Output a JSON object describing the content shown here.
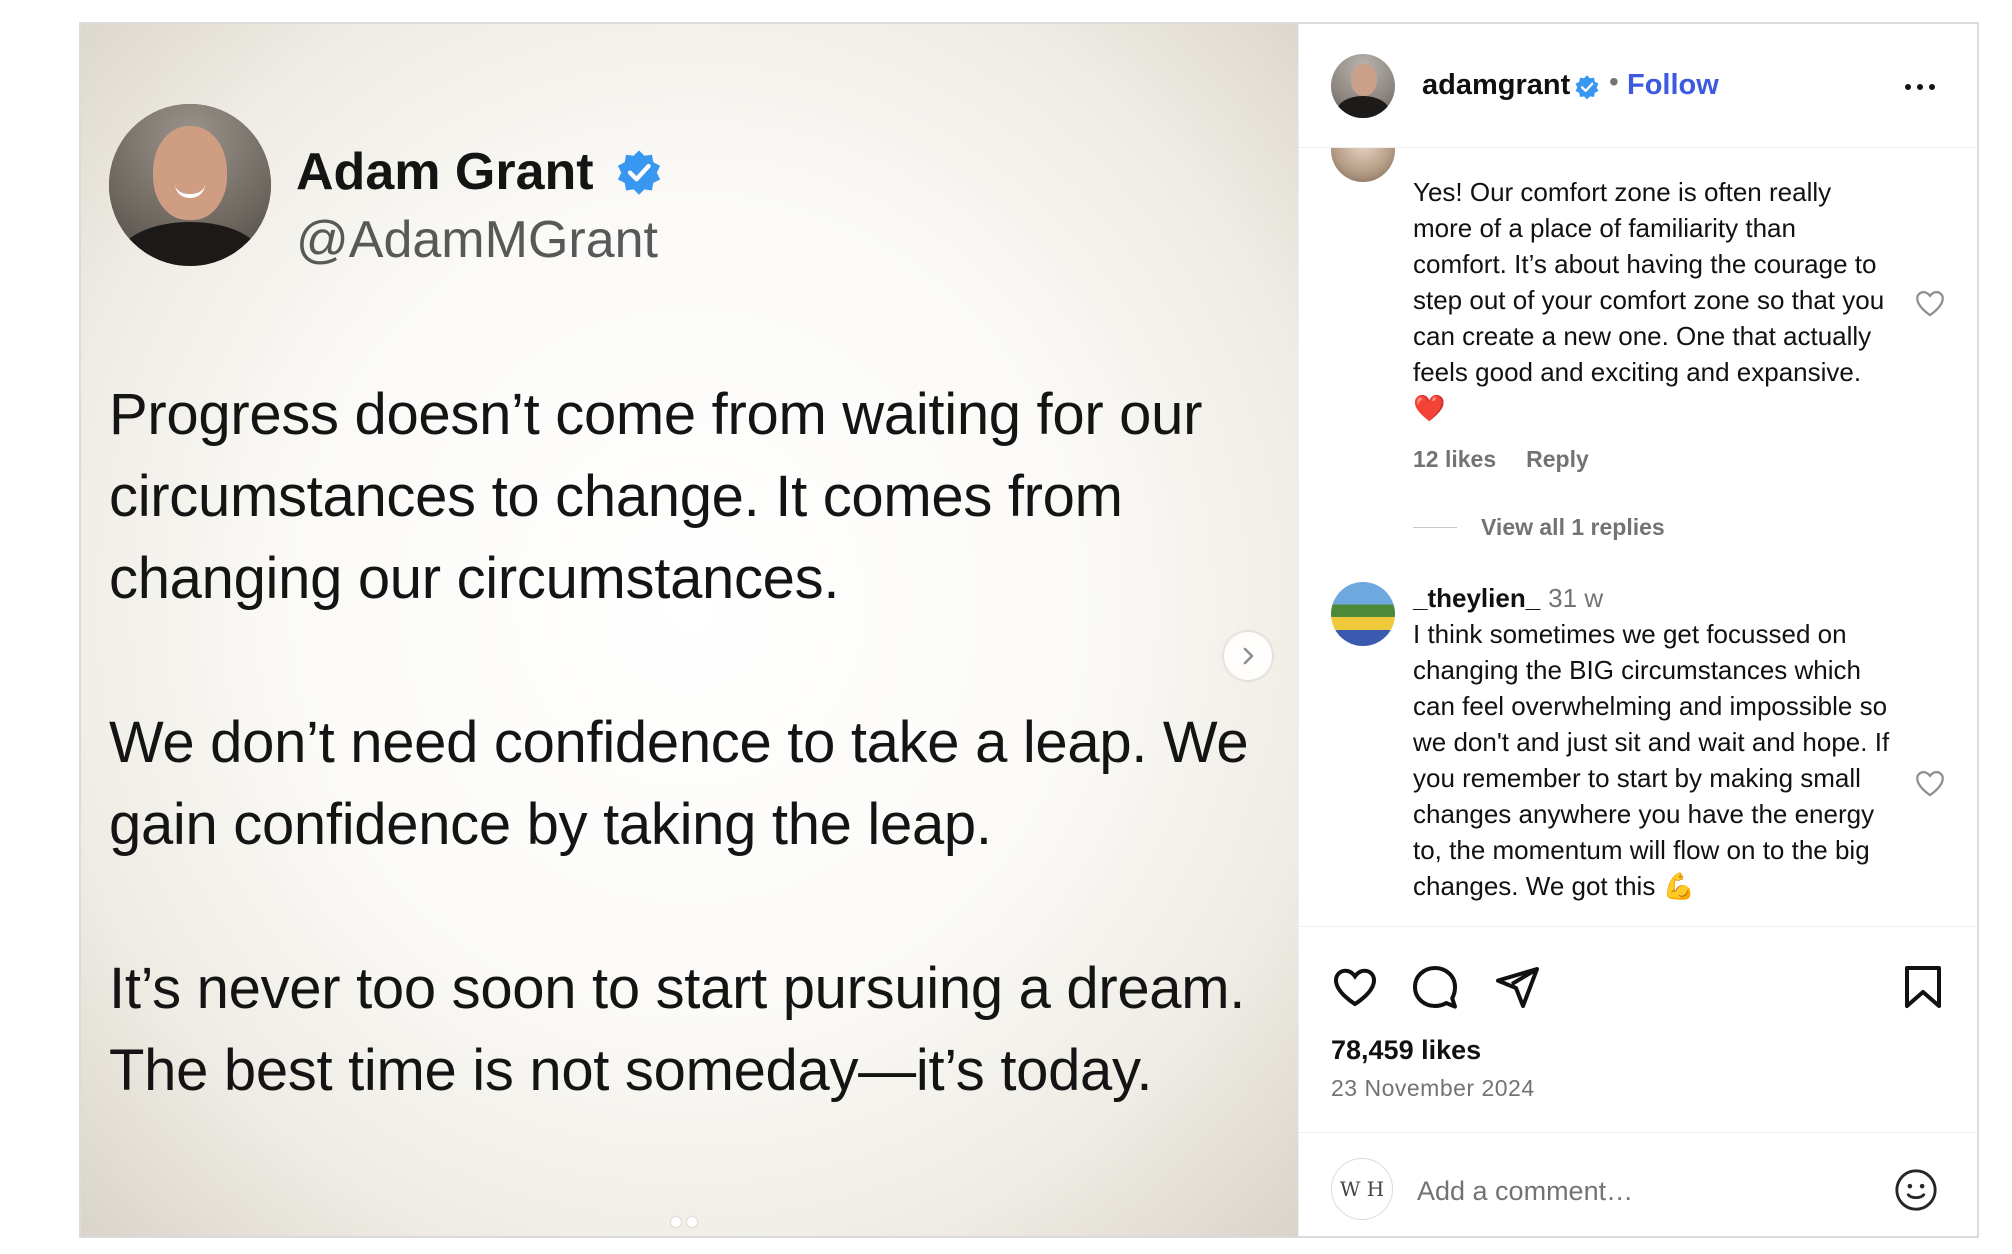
{
  "tweet": {
    "name": "Adam Grant",
    "handle": "@AdamMGrant",
    "body": "Progress doesn’t come from waiting for our circumstances to change. It comes from changing our circumstances.\n\nWe don’t need confidence to take a leap. We gain confidence by taking the leap.\n\nIt’s never too soon to start pursuing a dream. The best time is not someday—it’s today."
  },
  "post_header": {
    "username": "adamgrant",
    "separator": "•",
    "follow_label": "Follow"
  },
  "comments": [
    {
      "text": "Yes! Our comfort zone is often really more of a place of familiarity than comfort. It’s about having the courage to step out of your comfort zone so that you can create a new one. One that actually feels good and exciting and expansive.❤️",
      "likes": "12 likes",
      "reply_label": "Reply",
      "view_replies": "View all 1 replies"
    },
    {
      "username": "_theylien_",
      "time": "31 w",
      "text": "I think sometimes we get focussed on changing the BIG circumstances which can feel overwhelming and impossible so we don't and just sit and wait and hope. If you remember to start by making small changes anywhere you have the energy to, the momentum will flow on to the big changes. We got this 💪"
    }
  ],
  "post_stats": {
    "likes": "78,459 likes",
    "date": "23 November 2024"
  },
  "comment_box": {
    "placeholder": "Add a comment…",
    "avatar_text": "W H"
  },
  "colors": {
    "follow_blue": "#3c5ae0",
    "verified_blue": "#3897f0",
    "muted_text": "#737373",
    "heart_red": "#e0245e"
  },
  "icons": [
    "verified-badge-icon",
    "chevron-right-icon",
    "more-options-icon",
    "heart-icon",
    "comment-icon",
    "share-icon",
    "bookmark-icon",
    "emoji-icon"
  ]
}
